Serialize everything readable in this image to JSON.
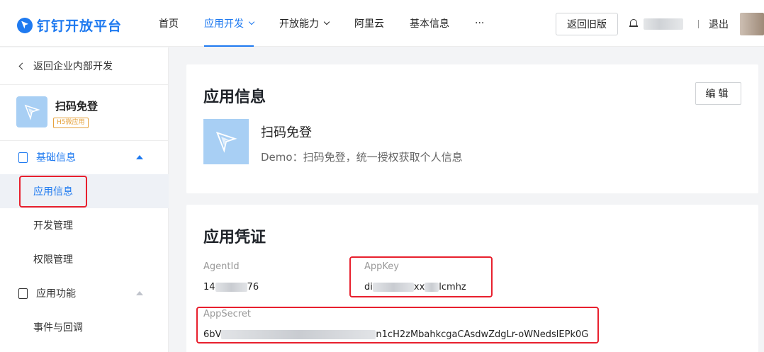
{
  "header": {
    "logo_text": "钉钉开放平台",
    "nav": [
      {
        "label": "首页"
      },
      {
        "label": "应用开发"
      },
      {
        "label": "开放能力"
      },
      {
        "label": "阿里云"
      },
      {
        "label": "基本信息"
      },
      {
        "label": "···"
      }
    ],
    "back_old_label": "返回旧版",
    "logout_label": "退出"
  },
  "sidebar": {
    "back_label": "返回企业内部开发",
    "app_name": "扫码免登",
    "app_tag": "H5微应用",
    "groups": [
      {
        "label": "基础信息"
      },
      {
        "label": "应用功能"
      }
    ],
    "items": [
      {
        "label": "应用信息"
      },
      {
        "label": "开发管理"
      },
      {
        "label": "权限管理"
      },
      {
        "label": "事件与回调"
      }
    ]
  },
  "app_info": {
    "title": "应用信息",
    "edit_label": "编辑",
    "app_name": "扫码免登",
    "description": "Demo：扫码免登，统一授权获取个人信息"
  },
  "credentials": {
    "title": "应用凭证",
    "agentid_label": "AgentId",
    "agentid_prefix": "14",
    "agentid_suffix": "76",
    "appkey_label": "AppKey",
    "appkey_prefix": "di",
    "appkey_mid": "xx",
    "appkey_suffix": "lcmhz",
    "appsecret_label": "AppSecret",
    "appsecret_prefix": "6bV",
    "appsecret_suffix": "n1cH2zMbahkcgaCAsdwZdgLr-oWNedslEPk0G"
  },
  "colors": {
    "accent": "#1f7af0",
    "highlight_box": "#e8202e",
    "tag": "#e6a23c"
  }
}
